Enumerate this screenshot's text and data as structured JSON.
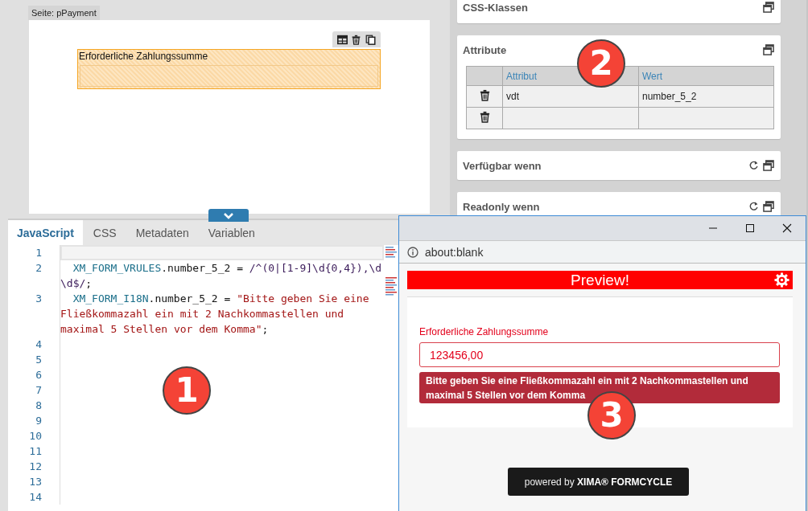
{
  "designer": {
    "page_tab": "Seite: pPayment",
    "field": {
      "label": "Erforderliche Zahlungssumme",
      "selected": true
    }
  },
  "editor": {
    "tabs": [
      {
        "label": "JavaScript",
        "selected": true
      },
      {
        "label": "CSS",
        "selected": false
      },
      {
        "label": "Metadaten",
        "selected": false
      },
      {
        "label": "Variablen",
        "selected": false
      }
    ],
    "lines": [
      {
        "number": "1",
        "active": true
      },
      {
        "number": "2",
        "active": false,
        "tokens": [
          {
            "kind": "variable",
            "text": "XM_FORM_VRULES"
          },
          {
            "kind": "plain",
            "text": ".number_5_2 = "
          },
          {
            "kind": "regex",
            "text": "/^(0|[1-9]\\d{0,4}),\\d\\d$/"
          },
          {
            "kind": "plain",
            "text": ";"
          }
        ]
      },
      {
        "number": "3",
        "active": false,
        "tokens": [
          {
            "kind": "variable",
            "text": "XM_FORM_I18N"
          },
          {
            "kind": "plain",
            "text": ".number_5_2 = "
          },
          {
            "kind": "string",
            "text": "\"Bitte geben Sie eine Fließkommazahl ein mit 2 Nachkommastellen und maximal 5 Stellen vor dem Komma\""
          },
          {
            "kind": "plain",
            "text": ";"
          }
        ]
      },
      {
        "number": "4",
        "active": false
      },
      {
        "number": "5",
        "active": false
      },
      {
        "number": "6",
        "active": false
      },
      {
        "number": "7",
        "active": false
      },
      {
        "number": "8",
        "active": false
      },
      {
        "number": "9",
        "active": false
      },
      {
        "number": "10",
        "active": false
      },
      {
        "number": "11",
        "active": false
      },
      {
        "number": "12",
        "active": false
      },
      {
        "number": "13",
        "active": false
      },
      {
        "number": "14",
        "active": false
      }
    ],
    "callout": "1"
  },
  "properties": {
    "panels": [
      {
        "title": "CSS-Klassen",
        "kind": "plain"
      },
      {
        "title": "Attribute",
        "kind": "table",
        "callout": "2",
        "columns": [
          "Attribut",
          "Wert"
        ],
        "rows": [
          {
            "attribute": "vdt",
            "value": "number_5_2"
          },
          {}
        ]
      },
      {
        "title": "Verfügbar wenn",
        "kind": "condition"
      },
      {
        "title": "Readonly wenn",
        "kind": "condition"
      }
    ]
  },
  "preview_window": {
    "address": "about:blank",
    "banner": "Preview!",
    "field": {
      "label": "Erforderliche Zahlungssumme",
      "value": "123456,00",
      "invalid": true,
      "error": "Bitte geben Sie eine Fließkommazahl ein mit 2 Nachkommastellen und maximal 5 Stellen vor dem Komma"
    },
    "callout": "3",
    "footer": "powered by **XIMA® FORMCYCLE**"
  }
}
